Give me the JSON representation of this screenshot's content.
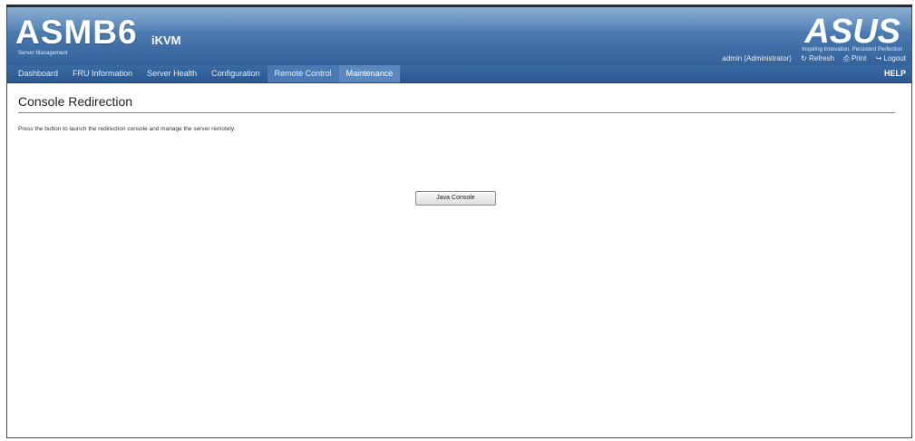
{
  "header": {
    "brand": "ASMB6",
    "brand_sub": "iKVM",
    "brand_tag": "Server Management",
    "logo_text": "ASUS",
    "logo_tag": "Inspiring Innovation, Persistent Perfection",
    "utility_links": {
      "admin": "admin (Administrator)",
      "refresh": "Refresh",
      "print": "Print",
      "logout": "Logout"
    }
  },
  "nav": {
    "items": [
      {
        "label": "Dashboard"
      },
      {
        "label": "FRU Information"
      },
      {
        "label": "Server Health"
      },
      {
        "label": "Configuration"
      },
      {
        "label": "Remote Control"
      },
      {
        "label": "Maintenance"
      }
    ],
    "active_item": "Maintenance",
    "help_label": "HELP"
  },
  "main": {
    "title": "Console Redirection",
    "description": "Press the button to launch the redirection console and manage the server remotely.",
    "java_console_button": "Java Console"
  },
  "colors": {
    "header_blue": "#4a7bb0",
    "nav_blue": "#2c5890",
    "nav_active": "#5b89bf"
  }
}
